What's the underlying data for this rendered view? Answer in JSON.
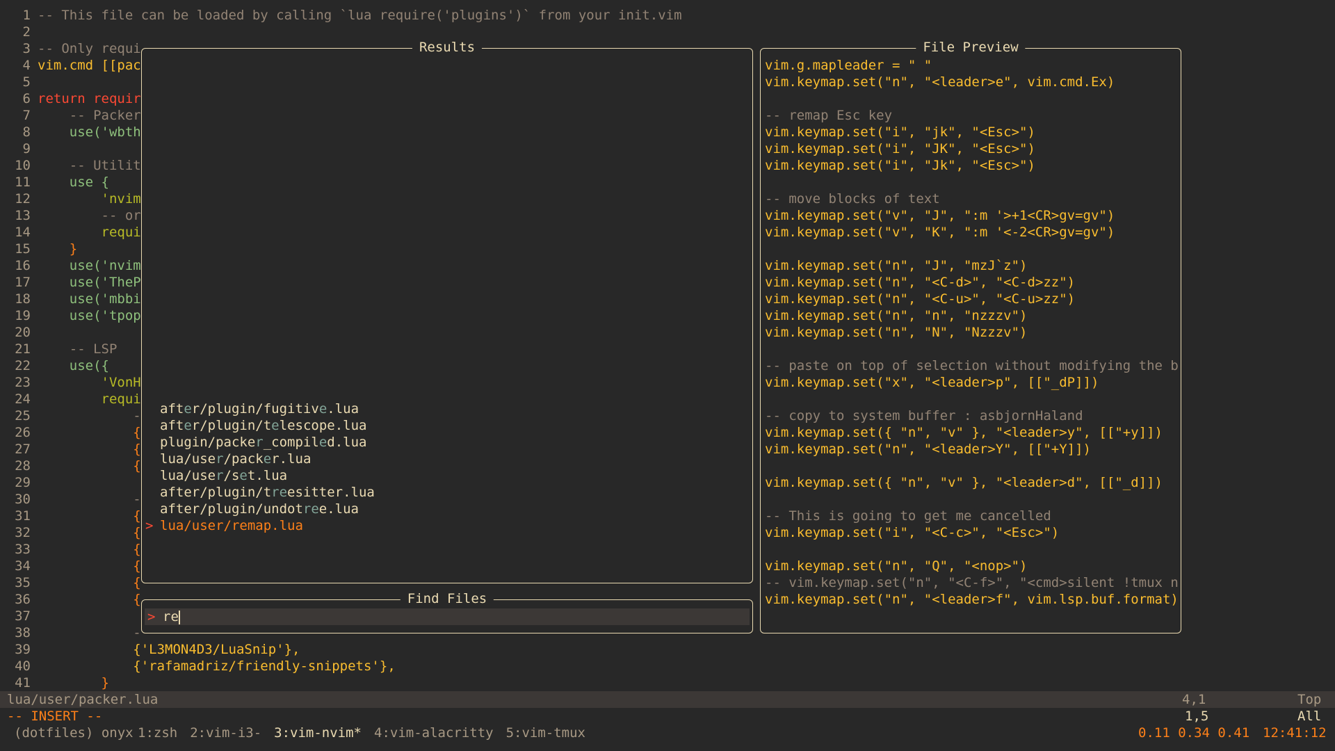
{
  "buffer": {
    "lines": [
      {
        "n": "1",
        "t": "-- This file can be loaded by calling `lua require('plugins')` from your init.vim",
        "k": "comment"
      },
      {
        "n": "2",
        "t": "",
        "k": "plain"
      },
      {
        "n": "3",
        "t": "-- Only requi",
        "k": "comment"
      },
      {
        "n": "4",
        "t": "vim.cmd [[pac",
        "k": "vimcmd"
      },
      {
        "n": "5",
        "t": "",
        "k": "plain"
      },
      {
        "n": "6",
        "t": "return requir",
        "k": "return"
      },
      {
        "n": "7",
        "t": "    -- Packer",
        "k": "comment"
      },
      {
        "n": "8",
        "t": "    use('wbth",
        "k": "use"
      },
      {
        "n": "9",
        "t": "",
        "k": "plain"
      },
      {
        "n": "10",
        "t": "    -- Utilit",
        "k": "comment"
      },
      {
        "n": "11",
        "t": "    use {",
        "k": "use"
      },
      {
        "n": "12",
        "t": "        'nvim",
        "k": "string"
      },
      {
        "n": "13",
        "t": "        -- or",
        "k": "comment"
      },
      {
        "n": "14",
        "t": "        requi",
        "k": "string"
      },
      {
        "n": "15",
        "t": "    }",
        "k": "brace"
      },
      {
        "n": "16",
        "t": "    use('nvim",
        "k": "use"
      },
      {
        "n": "17",
        "t": "    use('TheP",
        "k": "use"
      },
      {
        "n": "18",
        "t": "    use('mbbi",
        "k": "use"
      },
      {
        "n": "19",
        "t": "    use('tpop",
        "k": "use"
      },
      {
        "n": "20",
        "t": "",
        "k": "plain"
      },
      {
        "n": "21",
        "t": "    -- LSP",
        "k": "comment"
      },
      {
        "n": "22",
        "t": "    use({",
        "k": "use"
      },
      {
        "n": "23",
        "t": "        'VonH",
        "k": "string"
      },
      {
        "n": "24",
        "t": "        requi",
        "k": "string"
      },
      {
        "n": "25",
        "t": "            -",
        "k": "comment"
      },
      {
        "n": "26",
        "t": "            {",
        "k": "brace"
      },
      {
        "n": "27",
        "t": "            {",
        "k": "brace"
      },
      {
        "n": "28",
        "t": "            {",
        "k": "brace"
      },
      {
        "n": "29",
        "t": "",
        "k": "plain"
      },
      {
        "n": "30",
        "t": "            -",
        "k": "comment"
      },
      {
        "n": "31",
        "t": "            {",
        "k": "brace"
      },
      {
        "n": "32",
        "t": "            {",
        "k": "brace"
      },
      {
        "n": "33",
        "t": "            {",
        "k": "brace"
      },
      {
        "n": "34",
        "t": "            {",
        "k": "brace"
      },
      {
        "n": "35",
        "t": "            {",
        "k": "brace"
      },
      {
        "n": "36",
        "t": "            {",
        "k": "brace"
      },
      {
        "n": "37",
        "t": "",
        "k": "plain"
      },
      {
        "n": "38",
        "t": "            -",
        "k": "comment"
      },
      {
        "n": "39",
        "t": "            {'L3MON4D3/LuaSnip'},",
        "k": "snip"
      },
      {
        "n": "40",
        "t": "            {'rafamadriz/friendly-snippets'},",
        "k": "snip"
      },
      {
        "n": "41",
        "t": "        }",
        "k": "brace"
      }
    ]
  },
  "results": {
    "title": "Results",
    "items": [
      {
        "parts": [
          [
            "aft",
            0
          ],
          [
            "e",
            1
          ],
          [
            "r/plugin/fugitiv",
            0
          ],
          [
            "e",
            1
          ],
          [
            ".lua",
            0
          ]
        ],
        "selected": false
      },
      {
        "parts": [
          [
            "aft",
            0
          ],
          [
            "e",
            1
          ],
          [
            "r/plugin/t",
            0
          ],
          [
            "e",
            1
          ],
          [
            "lescope.lua",
            0
          ]
        ],
        "selected": false
      },
      {
        "parts": [
          [
            "plugin/packe",
            0
          ],
          [
            "r",
            1
          ],
          [
            "_compil",
            0
          ],
          [
            "e",
            1
          ],
          [
            "d.lua",
            0
          ]
        ],
        "selected": false
      },
      {
        "parts": [
          [
            "lua/use",
            0
          ],
          [
            "r",
            1
          ],
          [
            "/pack",
            0
          ],
          [
            "e",
            1
          ],
          [
            "r.lua",
            0
          ]
        ],
        "selected": false
      },
      {
        "parts": [
          [
            "lua/use",
            0
          ],
          [
            "r",
            1
          ],
          [
            "/s",
            0
          ],
          [
            "e",
            1
          ],
          [
            "t.lua",
            0
          ]
        ],
        "selected": false
      },
      {
        "parts": [
          [
            "after/plugin/t",
            0
          ],
          [
            "re",
            1
          ],
          [
            "esitter.lua",
            0
          ]
        ],
        "selected": false
      },
      {
        "parts": [
          [
            "after/plugin/undot",
            0
          ],
          [
            "re",
            1
          ],
          [
            "e.lua",
            0
          ]
        ],
        "selected": false
      },
      {
        "parts": [
          [
            "lua/user/",
            0
          ],
          [
            "re",
            1
          ],
          [
            "map.lua",
            0
          ]
        ],
        "selected": true
      }
    ],
    "selected_prefix": ">"
  },
  "find": {
    "title": "Find Files",
    "prompt": ">",
    "query": "re"
  },
  "preview": {
    "title": "File Preview",
    "lines": [
      "vim.g.mapleader = \" \"",
      "vim.keymap.set(\"n\", \"<leader>e\", vim.cmd.Ex)",
      "",
      "-- remap Esc key",
      "vim.keymap.set(\"i\", \"jk\", \"<Esc>\")",
      "vim.keymap.set(\"i\", \"JK\", \"<Esc>\")",
      "vim.keymap.set(\"i\", \"Jk\", \"<Esc>\")",
      "",
      "-- move blocks of text",
      "vim.keymap.set(\"v\", \"J\", \":m '>+1<CR>gv=gv\")",
      "vim.keymap.set(\"v\", \"K\", \":m '<-2<CR>gv=gv\")",
      "",
      "vim.keymap.set(\"n\", \"J\", \"mzJ`z\")",
      "vim.keymap.set(\"n\", \"<C-d>\", \"<C-d>zz\")",
      "vim.keymap.set(\"n\", \"<C-u>\", \"<C-u>zz\")",
      "vim.keymap.set(\"n\", \"n\", \"nzzzv\")",
      "vim.keymap.set(\"n\", \"N\", \"Nzzzv\")",
      "",
      "-- paste on top of selection without modifying the buf",
      "vim.keymap.set(\"x\", \"<leader>p\", [[\"_dP]])",
      "",
      "-- copy to system buffer : asbjornHaland",
      "vim.keymap.set({ \"n\", \"v\" }, \"<leader>y\", [[\"+y]])",
      "vim.keymap.set(\"n\", \"<leader>Y\", [[\"+Y]])",
      "",
      "vim.keymap.set({ \"n\", \"v\" }, \"<leader>d\", [[\"_d]])",
      "",
      "-- This is going to get me cancelled",
      "vim.keymap.set(\"i\", \"<C-c>\", \"<Esc>\")",
      "",
      "vim.keymap.set(\"n\", \"Q\", \"<nop>\")",
      "-- vim.keymap.set(\"n\", \"<C-f>\", \"<cmd>silent !tmux new",
      "vim.keymap.set(\"n\", \"<leader>f\", vim.lsp.buf.format)"
    ]
  },
  "status": {
    "filename": "lua/user/packer.lua",
    "position": "4,1",
    "scroll": "Top"
  },
  "mode": {
    "label": "-- INSERT --",
    "position": "1,5",
    "scroll": "All"
  },
  "tmux": {
    "session": "(dotfiles) onyx",
    "tabs": [
      {
        "label": "1:zsh",
        "active": false
      },
      {
        "label": "2:vim-i3-",
        "active": false
      },
      {
        "label": "3:vim-nvim*",
        "active": true
      },
      {
        "label": "4:vim-alacritty",
        "active": false
      },
      {
        "label": "5:vim-tmux",
        "active": false
      }
    ],
    "load": "0.11 0.34 0.41",
    "clock": "12:41:12"
  }
}
